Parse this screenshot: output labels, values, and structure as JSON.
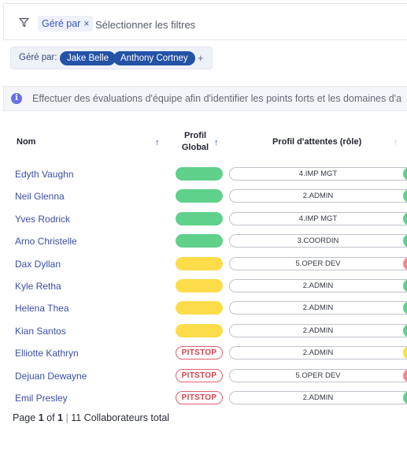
{
  "filter": {
    "chip_label": "Géré par",
    "chip_close": "×",
    "placeholder": "Sélectionner les filtres"
  },
  "manager_filter": {
    "label": "Géré par:",
    "people": [
      "Jake Belle",
      "Anthony Cortney"
    ],
    "add": "+"
  },
  "info": {
    "icon": "i",
    "text": "Effectuer des évaluations d'équipe afin d'identifier les points forts et les domaines d'a"
  },
  "table": {
    "headers": {
      "nom": "Nom",
      "profil_line1": "Profil",
      "profil_line2": "Global",
      "attentes": "Profil d'attentes (rôle)"
    },
    "sort_icon": "↑",
    "rows": [
      {
        "name": "Edyth Vaughn",
        "status": "green",
        "status_label": "",
        "role": "4.IMP MGT",
        "edge": "green"
      },
      {
        "name": "Neil Glenna",
        "status": "green",
        "status_label": "",
        "role": "2.ADMIN",
        "edge": "green"
      },
      {
        "name": "Yves Rodrick",
        "status": "green",
        "status_label": "",
        "role": "4.IMP MGT",
        "edge": "green"
      },
      {
        "name": "Arno Christelle",
        "status": "green",
        "status_label": "",
        "role": "3.COORDIN",
        "edge": "green"
      },
      {
        "name": "Dax Dyllan",
        "status": "yellow",
        "status_label": "",
        "role": "5.OPER DEV",
        "edge": "red"
      },
      {
        "name": "Kyle Retha",
        "status": "yellow",
        "status_label": "",
        "role": "2.ADMIN",
        "edge": "green"
      },
      {
        "name": "Helena Thea",
        "status": "yellow",
        "status_label": "",
        "role": "2.ADMIN",
        "edge": "green"
      },
      {
        "name": "Kian Santos",
        "status": "yellow",
        "status_label": "",
        "role": "2.ADMIN",
        "edge": "green"
      },
      {
        "name": "Elliotte Kathryn",
        "status": "pitstop",
        "status_label": "PITSTOP",
        "role": "2.ADMIN",
        "edge": "yellow"
      },
      {
        "name": "Dejuan Dewayne",
        "status": "pitstop",
        "status_label": "PITSTOP",
        "role": "5.OPER DEV",
        "edge": "red"
      },
      {
        "name": "Emil Presley",
        "status": "pitstop",
        "status_label": "PITSTOP",
        "role": "2.ADMIN",
        "edge": "green"
      }
    ]
  },
  "pager": {
    "page_word": "Page",
    "current": "1",
    "of_word": "of",
    "total_pages": "1",
    "separator": "|",
    "total_text": "11 Collaborateurs total"
  }
}
